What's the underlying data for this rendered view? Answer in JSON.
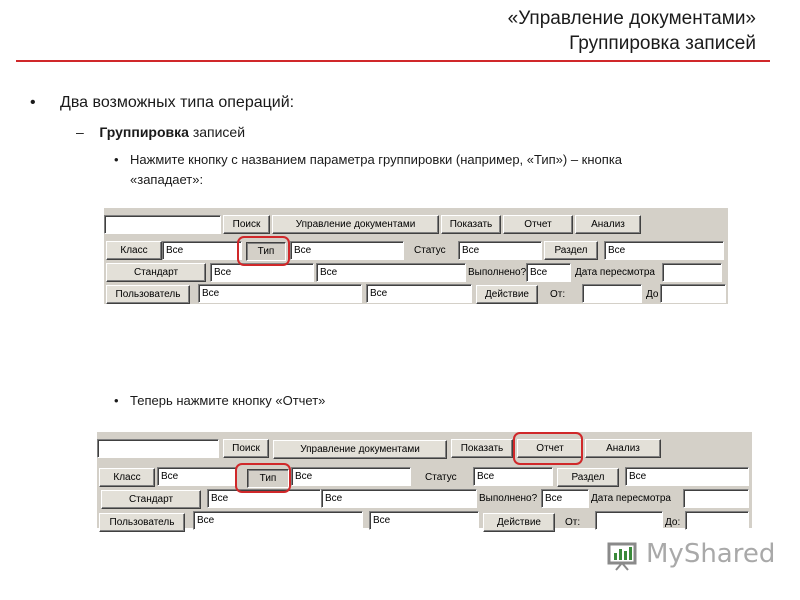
{
  "slide": {
    "title_line1": "«Управление документами»",
    "title_line2": "Группировка записей",
    "bullet1": "Два возможных типа операций:",
    "sub_bullet_bold": "Группировка",
    "sub_bullet_rest": " записей",
    "step1_line1": "Нажмите кнопку с названием параметра группировки (например, «Тип») – кнопка",
    "step1_line2": "«западает»:",
    "step2": "Теперь нажмите кнопку «Отчет»",
    "bullet_mark": "•",
    "dash_mark": "–"
  },
  "app": {
    "search_value": "",
    "search_button": "Поиск",
    "module_button": "Управление документами",
    "show_button": "Показать",
    "report_button": "Отчет",
    "analysis_button": "Анализ",
    "class_button": "Класс",
    "class_value": "Все",
    "type_button": "Тип",
    "type_value": "Все",
    "status_button": "Статус",
    "status_value": "Все",
    "section_button": "Раздел",
    "section_value": "Все",
    "standard_button": "Стандарт",
    "standard_value_1": "Все",
    "standard_value_2": "Все",
    "done_label": "Выполнено?",
    "done_value": "Все",
    "review_date_label": "Дата пересмотра",
    "review_date_value": "",
    "user_button": "Пользователь",
    "user_value_1": "Все",
    "user_value_2": "Все",
    "action_button": "Действие",
    "from_label": "От:",
    "from_value": "",
    "to_label_1": "До",
    "to_label_2": "До:"
  },
  "logo": {
    "text": "MyShared",
    "icon": "myshared-logo-icon"
  },
  "colors": {
    "accent": "#d0282a",
    "panel": "#d4d0c8"
  }
}
